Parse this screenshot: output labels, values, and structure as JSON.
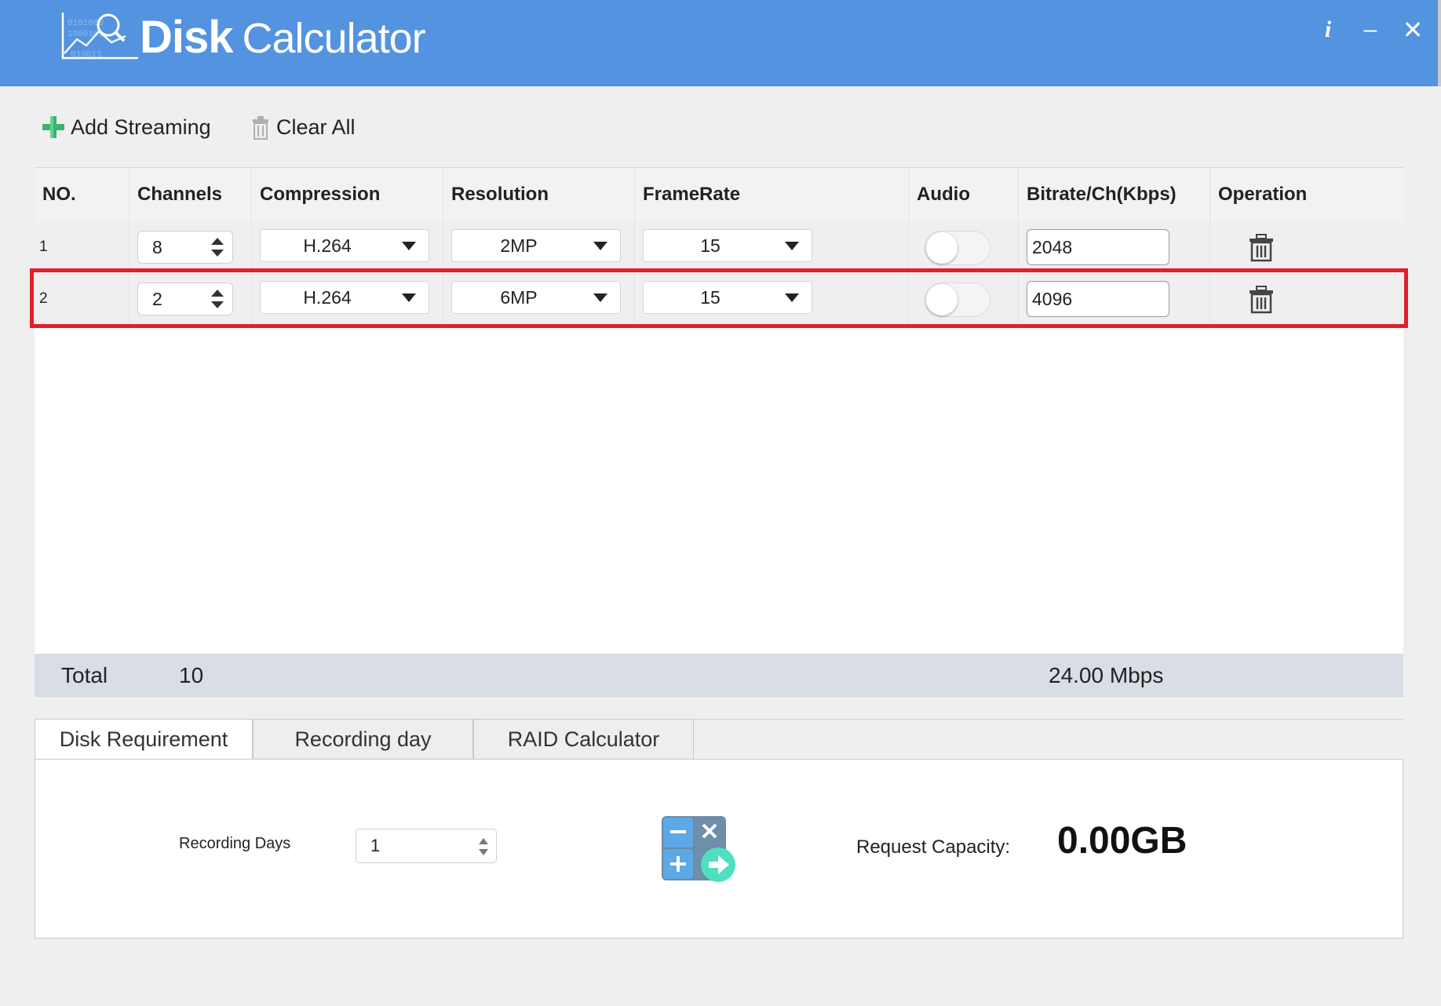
{
  "app": {
    "title_bold": "Disk",
    "title_light": "Calculator",
    "info_label": "i",
    "minimize_label": "–",
    "close_label": "✕"
  },
  "toolbar": {
    "add_label": "Add Streaming",
    "clear_label": "Clear All"
  },
  "table": {
    "headers": {
      "no": "NO.",
      "channels": "Channels",
      "compression": "Compression",
      "resolution": "Resolution",
      "framerate": "FrameRate",
      "audio": "Audio",
      "bitrate": "Bitrate/Ch(Kbps)",
      "operation": "Operation"
    },
    "rows": [
      {
        "no": "1",
        "channels": "8",
        "compression": "H.264",
        "resolution": "2MP",
        "framerate": "15",
        "audio_on": false,
        "bitrate": "2048"
      },
      {
        "no": "2",
        "channels": "2",
        "compression": "H.264",
        "resolution": "6MP",
        "framerate": "15",
        "audio_on": false,
        "bitrate": "4096"
      }
    ],
    "highlighted_row": 2
  },
  "totals": {
    "label": "Total",
    "channels": "10",
    "bandwidth": "24.00 Mbps"
  },
  "tabs": [
    {
      "label": "Disk Requirement",
      "active": true
    },
    {
      "label": "Recording day",
      "active": false
    },
    {
      "label": "RAID Calculator",
      "active": false
    }
  ],
  "disk_requirement": {
    "recording_days_label": "Recording Days",
    "recording_days_value": "1",
    "request_capacity_label": "Request Capacity:",
    "request_capacity_value": "0.00GB"
  },
  "icons": {
    "logo": "chart-magnifier-icon",
    "add": "plus-icon",
    "clear": "trash-icon",
    "delete": "trash-icon",
    "calculate": "calculator-icon"
  },
  "colors": {
    "titlebar": "#5393e0",
    "highlight": "#e0202d",
    "plus": "#3cb371",
    "total_bar": "#d8dde6"
  }
}
